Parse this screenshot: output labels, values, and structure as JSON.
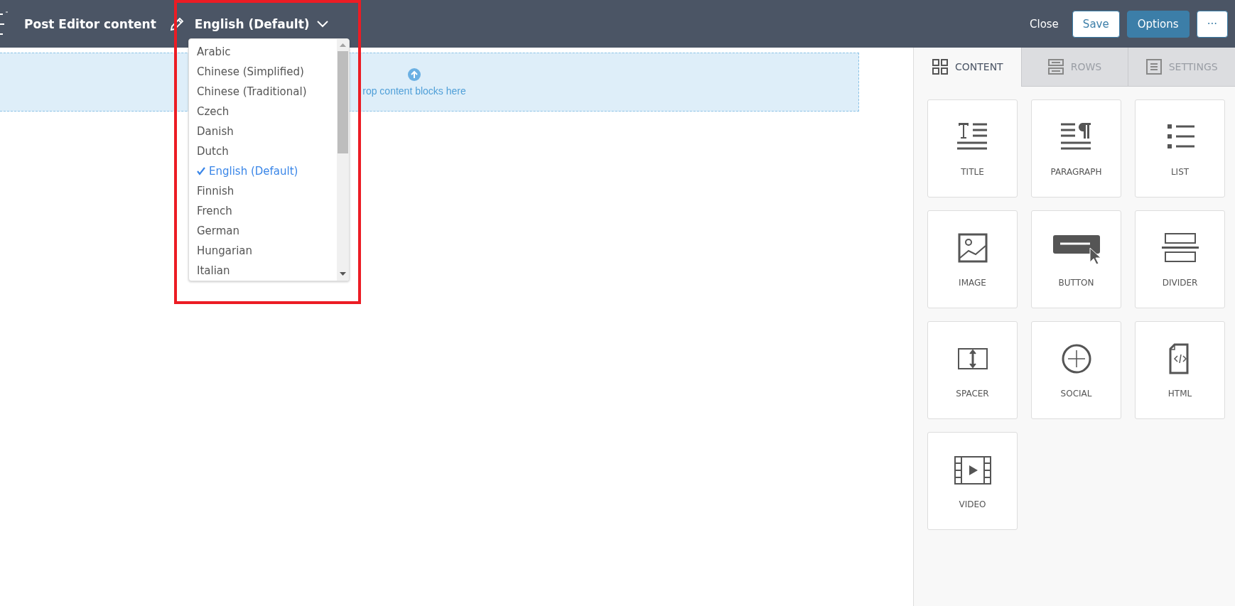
{
  "header": {
    "title": "Post Editor content",
    "language": "English (Default)",
    "actions": [
      {
        "label": "Close",
        "kind": "link"
      },
      {
        "label": "Save",
        "kind": "outline"
      },
      {
        "label": "Options",
        "kind": "primary"
      },
      {
        "label": "···",
        "kind": "outline"
      }
    ]
  },
  "language_menu": {
    "items": [
      {
        "label": "Arabic",
        "selected": false
      },
      {
        "label": "Chinese (Simplified)",
        "selected": false
      },
      {
        "label": "Chinese (Traditional)",
        "selected": false
      },
      {
        "label": "Czech",
        "selected": false
      },
      {
        "label": "Danish",
        "selected": false
      },
      {
        "label": "Dutch",
        "selected": false
      },
      {
        "label": "English (Default)",
        "selected": true
      },
      {
        "label": "Finnish",
        "selected": false
      },
      {
        "label": "French",
        "selected": false
      },
      {
        "label": "German",
        "selected": false
      },
      {
        "label": "Hungarian",
        "selected": false
      },
      {
        "label": "Italian",
        "selected": false
      }
    ]
  },
  "drop_zone": {
    "text": "rop content blocks here"
  },
  "sidebar": {
    "tabs": [
      {
        "label": "CONTENT",
        "kind": "content",
        "selected": true
      },
      {
        "label": "ROWS",
        "kind": "rows",
        "selected": false
      },
      {
        "label": "SETTINGS",
        "kind": "settings",
        "selected": false
      }
    ],
    "blocks": [
      {
        "label": "TITLE",
        "kind": "title"
      },
      {
        "label": "PARAGRAPH",
        "kind": "paragraph"
      },
      {
        "label": "LIST",
        "kind": "list"
      },
      {
        "label": "IMAGE",
        "kind": "image"
      },
      {
        "label": "BUTTON",
        "kind": "button"
      },
      {
        "label": "DIVIDER",
        "kind": "divider"
      },
      {
        "label": "SPACER",
        "kind": "spacer"
      },
      {
        "label": "SOCIAL",
        "kind": "social"
      },
      {
        "label": "HTML",
        "kind": "html"
      },
      {
        "label": "VIDEO",
        "kind": "video"
      }
    ]
  }
}
